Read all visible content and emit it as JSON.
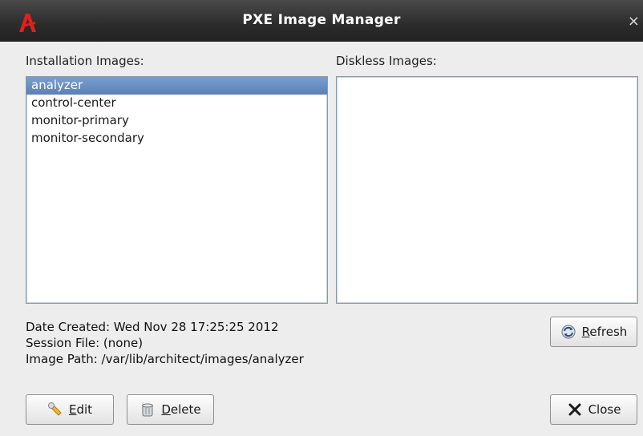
{
  "window": {
    "title": "PXE Image Manager",
    "close_glyph": "×"
  },
  "installation": {
    "label": "Installation Images:",
    "items": [
      "analyzer",
      "control-center",
      "monitor-primary",
      "monitor-secondary"
    ],
    "selected": "analyzer"
  },
  "diskless": {
    "label": "Diskless Images:",
    "items": []
  },
  "details": {
    "date_created": "Date Created:  Wed Nov 28 17:25:25 2012",
    "session_file": "Session File:  (none)",
    "image_path": "Image Path:  /var/lib/architect/images/analyzer"
  },
  "buttons": {
    "refresh": "Refresh",
    "edit": "Edit",
    "delete": "Delete",
    "close": "Close"
  },
  "icons": {
    "app": "architect-logo-icon",
    "refresh": "refresh-icon",
    "edit": "wrench-icon",
    "delete": "trash-icon",
    "close": "x-close-icon"
  },
  "colors": {
    "selection": "#5a80b8",
    "titlebar": "#2b2b2b"
  }
}
